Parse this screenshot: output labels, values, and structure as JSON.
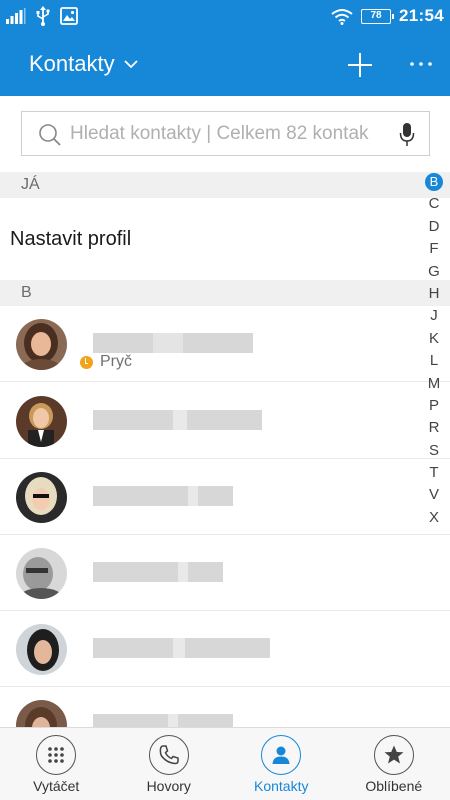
{
  "status_bar": {
    "time": "21:54",
    "battery": "78",
    "icons": [
      "signal-icon",
      "usb-icon",
      "image-icon",
      "wifi-icon",
      "battery-icon"
    ]
  },
  "app_bar": {
    "title": "Kontakty",
    "icons": [
      "chevron-down-icon",
      "plus-icon",
      "more-icon"
    ]
  },
  "search": {
    "placeholder": "Hledat kontakty | Celkem 82 kontak",
    "value": ""
  },
  "sections": {
    "me_header": "JÁ",
    "profile_label": "Nastavit profil",
    "b_header": "B"
  },
  "contacts": [
    {
      "status": "Pryč",
      "status_color": "#f2a21b"
    },
    {
      "status": ""
    },
    {
      "status": ""
    },
    {
      "status": ""
    },
    {
      "status": ""
    },
    {
      "status": ""
    }
  ],
  "alphabet_index": [
    "B",
    "C",
    "D",
    "F",
    "G",
    "H",
    "J",
    "K",
    "L",
    "M",
    "P",
    "R",
    "S",
    "T",
    "V",
    "X"
  ],
  "alphabet_active": "B",
  "bottom_nav": [
    {
      "label": "Vytáčet",
      "icon": "dialpad-icon",
      "active": false
    },
    {
      "label": "Hovory",
      "icon": "phone-icon",
      "active": false
    },
    {
      "label": "Kontakty",
      "icon": "person-icon",
      "active": true
    },
    {
      "label": "Oblíbené",
      "icon": "star-icon",
      "active": false
    }
  ],
  "colors": {
    "accent": "#1788d8",
    "away_status": "#f2a21b"
  }
}
